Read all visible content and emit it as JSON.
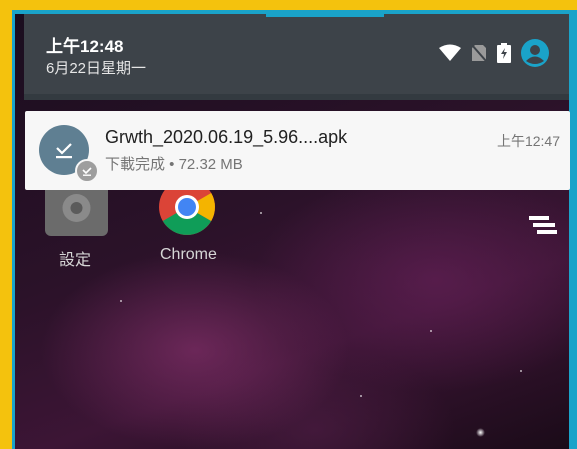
{
  "statusbar": {
    "time": "上午12:48",
    "date": "6月22日星期一",
    "icons": [
      "wifi-icon",
      "no-sim-icon",
      "battery-charging-icon",
      "account-icon"
    ]
  },
  "notification": {
    "title": "Grwth_2020.06.19_5.96....apk",
    "subtitle": "下載完成 • 72.32 MB",
    "time": "上午12:47",
    "icon": "download-complete-icon"
  },
  "home": {
    "apps": [
      {
        "label": "設定",
        "icon": "settings-icon"
      },
      {
        "label": "Chrome",
        "icon": "chrome-icon"
      }
    ]
  },
  "colors": {
    "outer_frame": "#f4c20d",
    "accent": "#1aa3c9",
    "shade": "#3d4349",
    "card": "#f7f7f7",
    "icon_bg": "#5f7f92"
  }
}
